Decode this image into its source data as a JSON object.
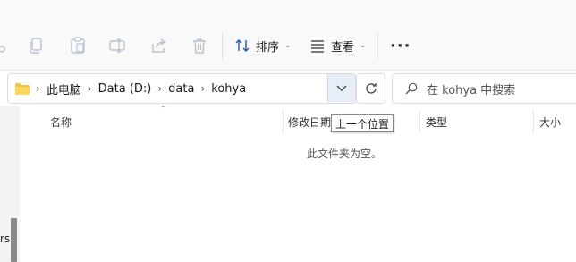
{
  "toolbar": {
    "sort_label": "排序",
    "view_label": "查看",
    "more_label": "···"
  },
  "address": {
    "crumbs": [
      "此电脑",
      "Data (D:)",
      "data",
      "kohya"
    ],
    "separator": "›"
  },
  "search": {
    "placeholder": "在 kohya 中搜索"
  },
  "columns": {
    "name": "名称",
    "modified": "修改日期",
    "type": "类型",
    "size": "大小"
  },
  "empty_message": "此文件夹为空。",
  "tooltip": "上一个位置",
  "sidebar": {
    "partial_text": "rs"
  },
  "colors": {
    "accent": "#1e5aa8",
    "folder": "#f4c542",
    "dropdown_active": "#e8eef7"
  }
}
